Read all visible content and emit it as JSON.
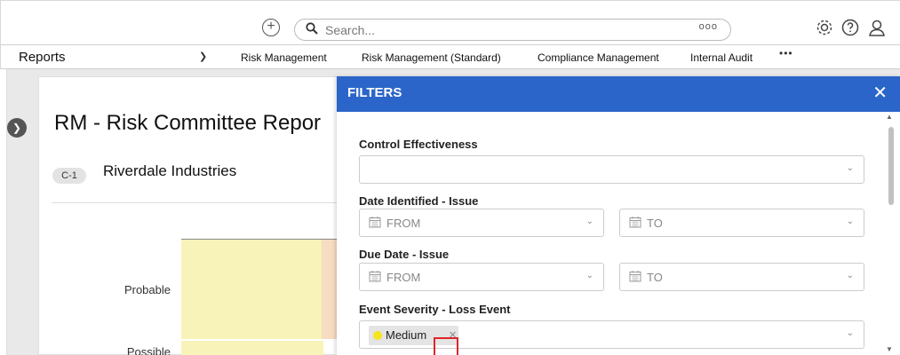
{
  "topbar": {
    "search_placeholder": "Search...",
    "search_more": "ooo",
    "icons": [
      "add-icon",
      "search-icon",
      "gear-icon",
      "help-icon",
      "user-icon"
    ]
  },
  "nav": {
    "section": "Reports",
    "tabs": [
      {
        "label": "Risk Management",
        "active": true
      },
      {
        "label": "Risk Management (Standard)",
        "active": false
      },
      {
        "label": "Compliance Management",
        "active": false
      },
      {
        "label": "Internal Audit",
        "active": false
      }
    ],
    "more": "•••"
  },
  "report": {
    "title": "RM - Risk Committee Repor",
    "badge": "C-1",
    "company": "Riverdale Industries",
    "rows": [
      "Probable",
      "Possible"
    ]
  },
  "filters": {
    "title": "FILTERS",
    "close": "✕",
    "fields": [
      {
        "label": "Control Effectiveness"
      },
      {
        "label": "Date Identified - Issue",
        "from": "FROM",
        "to": "TO"
      },
      {
        "label": "Due Date - Issue",
        "from": "FROM",
        "to": "TO"
      },
      {
        "label": "Event Severity - Loss Event",
        "chip": "Medium",
        "chip_color": "#f5e51d"
      }
    ]
  },
  "colors": {
    "accent": "#2b65c9",
    "highlight": "#e0262b"
  }
}
